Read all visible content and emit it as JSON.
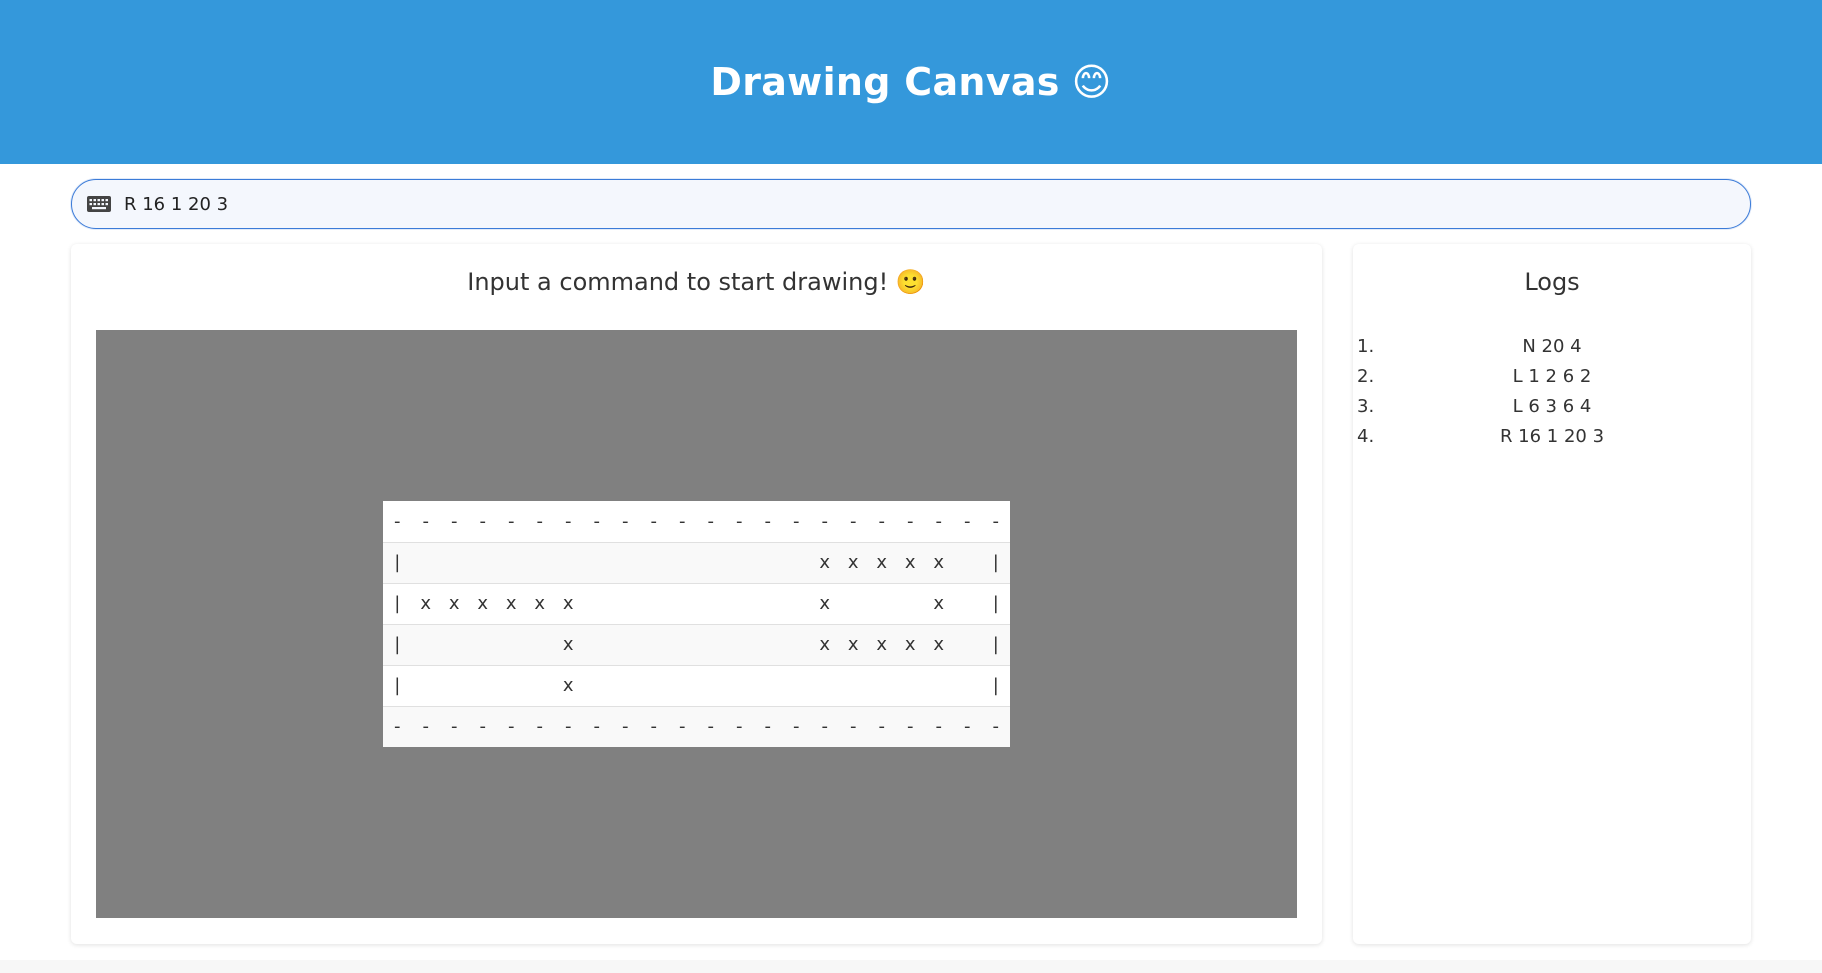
{
  "header": {
    "title": "Drawing Canvas",
    "emoji": "😊"
  },
  "command": {
    "value": "R 16 1 20 3",
    "icon": "keyboard-icon"
  },
  "main": {
    "title": "Input a command to start drawing! 🙂"
  },
  "grid": {
    "rows": [
      [
        "-",
        "-",
        "-",
        "-",
        "-",
        "-",
        "-",
        "-",
        "-",
        "-",
        "-",
        "-",
        "-",
        "-",
        "-",
        "-",
        "-",
        "-",
        "-",
        "-",
        "-",
        "-"
      ],
      [
        "|",
        "",
        "",
        "",
        "",
        "",
        "",
        "",
        "",
        "",
        "",
        "",
        "",
        "",
        "",
        "x",
        "x",
        "x",
        "x",
        "x",
        "",
        "|"
      ],
      [
        "|",
        "x",
        "x",
        "x",
        "x",
        "x",
        "x",
        "",
        "",
        "",
        "",
        "",
        "",
        "",
        "",
        "x",
        "",
        "",
        "",
        "x",
        "",
        "|"
      ],
      [
        "|",
        "",
        "",
        "",
        "",
        "",
        "x",
        "",
        "",
        "",
        "",
        "",
        "",
        "",
        "",
        "x",
        "x",
        "x",
        "x",
        "x",
        "",
        "|"
      ],
      [
        "|",
        "",
        "",
        "",
        "",
        "",
        "x",
        "",
        "",
        "",
        "",
        "",
        "",
        "",
        "",
        "",
        "",
        "",
        "",
        "",
        "",
        "|"
      ],
      [
        "-",
        "-",
        "-",
        "-",
        "-",
        "-",
        "-",
        "-",
        "-",
        "-",
        "-",
        "-",
        "-",
        "-",
        "-",
        "-",
        "-",
        "-",
        "-",
        "-",
        "-",
        "-"
      ]
    ]
  },
  "logs": {
    "title": "Logs",
    "items": [
      {
        "num": "1.",
        "text": "N 20 4"
      },
      {
        "num": "2.",
        "text": "L 1 2 6 2"
      },
      {
        "num": "3.",
        "text": "L 6 3 6 4"
      },
      {
        "num": "4.",
        "text": "R 16 1 20 3"
      }
    ]
  },
  "colors": {
    "header_bg": "#3498db",
    "canvas_bg": "#808080",
    "input_border": "#3b7bd8"
  }
}
